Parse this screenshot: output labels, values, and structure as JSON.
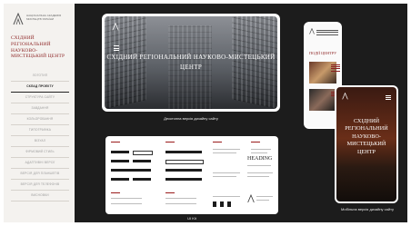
{
  "sidebar": {
    "logo_text": "НАЦІОНАЛЬНА АКАДЕМІЯ МИСТЕЦТВ УКРАЇНИ",
    "title": "СХІДНИЙ РЕГІОНАЛЬНИЙ НАУКОВО-МИСТЕЦЬКИЙ ЦЕНТР",
    "nav": [
      {
        "label": "ЛОГОТИП"
      },
      {
        "label": "СКЛАД ПРОЕКТУ",
        "active": true
      },
      {
        "label": "СТРУКТУРА САЙТУ"
      },
      {
        "label": "ЗАВДАННЯ"
      },
      {
        "label": "КОЛЬОРОВАННЯ"
      },
      {
        "label": "ТИПОГРАФІКА"
      },
      {
        "label": "ВІЗУАЛ"
      },
      {
        "label": "ФІРМОВИЙ СТИЛЬ"
      },
      {
        "label": "АДАПТИВНІ ВЕРСІЇ"
      },
      {
        "label": "ВЕРСІЯ ДЛЯ ПЛАНШЕТІВ"
      },
      {
        "label": "ВЕРСІЯ ДЛЯ ТЕЛЕФОНІВ"
      },
      {
        "label": "ВИСНОВКИ"
      }
    ]
  },
  "desktop": {
    "hero_title": "СХІДНИЙ РЕГІОНАЛЬНИЙ НАУКОВО-МИСТЕЦЬКИЙ ЦЕНТР",
    "caption": "Десктопна версія дизайну сайту"
  },
  "phone1": {
    "heading": "ПОДІЇ ЦЕНТРУ"
  },
  "phone2": {
    "title": "СХІДНИЙ РЕГІОНАЛЬНИЙ НАУКОВО-МИСТЕЦЬКИЙ ЦЕНТР",
    "caption": "Мобільна версія дизайну сайту"
  },
  "uikit": {
    "heading": "HEADING",
    "caption": "UI Kit"
  },
  "colors": {
    "accent": "#8a1f1f",
    "dark_bg": "#1c1c1c",
    "sidebar_bg": "#f4f2ef"
  }
}
